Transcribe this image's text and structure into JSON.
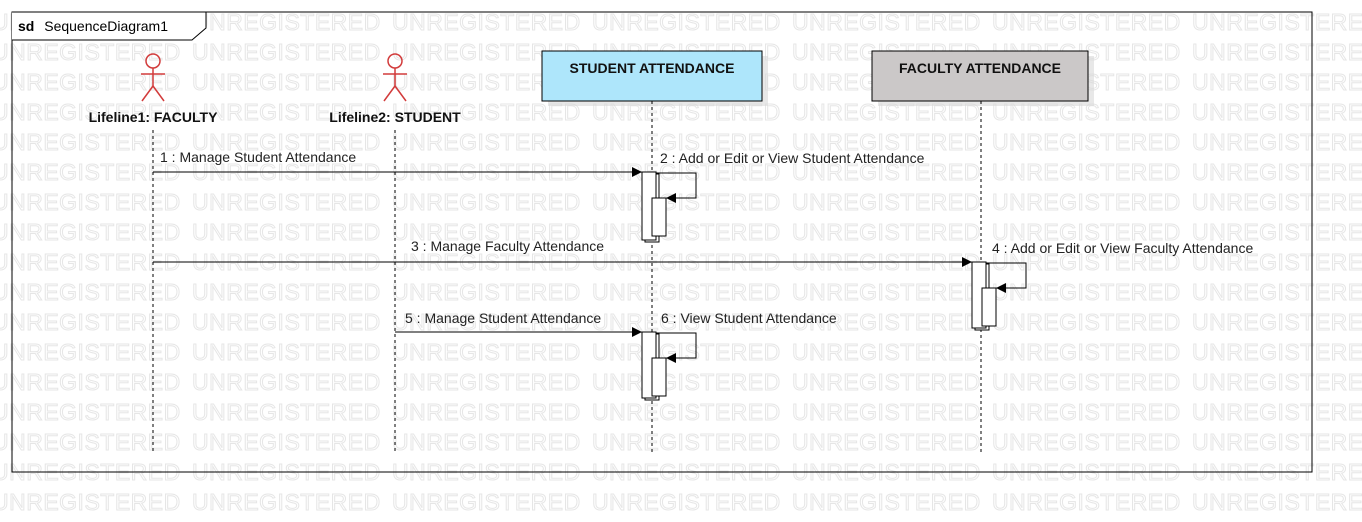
{
  "watermark": "UNREGISTERED",
  "frame": {
    "keyword": "sd",
    "name": "SequenceDiagram1"
  },
  "lifelines": [
    {
      "id": "faculty",
      "kind": "actor",
      "label": "Lifeline1: FACULTY"
    },
    {
      "id": "student",
      "kind": "actor",
      "label": "Lifeline2: STUDENT"
    },
    {
      "id": "student_att",
      "kind": "object",
      "label": "STUDENT ATTENDANCE",
      "fill": "#aee6fb"
    },
    {
      "id": "faculty_att",
      "kind": "object",
      "label": "FACULTY ATTENDANCE",
      "fill": "#cbc8c8"
    }
  ],
  "messages": [
    {
      "label": "1 : Manage Student Attendance",
      "from": "faculty",
      "to": "student_att",
      "type": "call"
    },
    {
      "label": "2 : Add or Edit or View Student Attendance",
      "from": "student_att",
      "to": "student_att",
      "type": "self"
    },
    {
      "label": "3 : Manage Faculty Attendance",
      "from": "faculty",
      "to": "faculty_att",
      "type": "call"
    },
    {
      "label": "4 : Add or Edit or View Faculty Attendance",
      "from": "faculty_att",
      "to": "faculty_att",
      "type": "self"
    },
    {
      "label": "5 : Manage Student Attendance",
      "from": "student",
      "to": "student_att",
      "type": "call"
    },
    {
      "label": "6 : View Student Attendance",
      "from": "student_att",
      "to": "student_att",
      "type": "self"
    }
  ],
  "colors": {
    "actor": "#d23b3b",
    "line": "#000000"
  }
}
